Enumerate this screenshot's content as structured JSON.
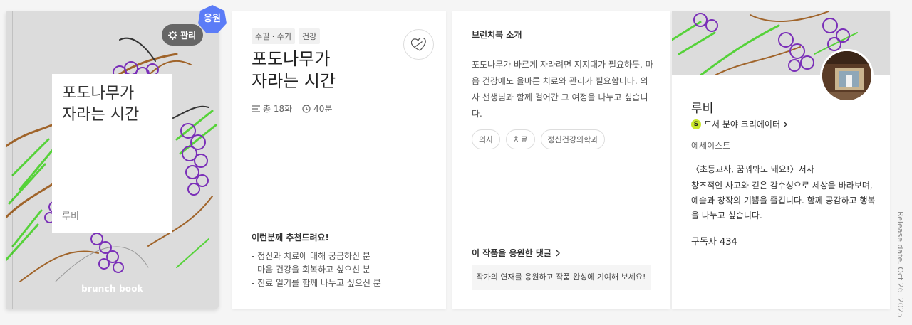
{
  "cover": {
    "title_line1": "포도나무가",
    "title_line2": "자라는 시간",
    "author": "루비",
    "brand": "brunch book",
    "manage_label": "관리",
    "badge_label": "응원"
  },
  "book": {
    "tags": [
      "수필 · 수기",
      "건강"
    ],
    "title_line1": "포도나무가",
    "title_line2": "자라는 시간",
    "episodes": "총 18화",
    "duration": "40분",
    "recommend_title": "이런분께 추천드려요!",
    "recommend_items": [
      "정신과 치료에 대해 궁금하신 분",
      "마음 건강을 회복하고 싶으신 분",
      "진료 일기를 함께 나누고 싶으신 분"
    ]
  },
  "intro": {
    "heading": "브런치북 소개",
    "text": "포도나무가 바르게 자라려면 지지대가 필요하듯, 마음 건강에도 올바른 치료와 관리가 필요합니다. 의사 선생님과 함께 걸어간 그 여정을 나누고 싶습니다.",
    "keywords": [
      "의사",
      "치료",
      "정신건강의학과"
    ],
    "comment_link": "이 작품을 응원한 댓글",
    "comment_prompt": "작가의 연재를 응원하고 작품 완성에 기여해 보세요!"
  },
  "author": {
    "name": "루비",
    "creator_badge": "S",
    "creator_label": "도서 분야 크리에이터",
    "job": "에세이스트",
    "books": "〈초등교사, 꿈꿔봐도 돼요!〉저자",
    "bio": "창조적인 사고와 깊은 감수성으로 세상을 바라보며, 예술과 창작의 기쁨을 즐깁니다. 함께 공감하고 행복을 나누고 싶습니다.",
    "subscribers": "구독자 434"
  },
  "release_date": "Release date. Oct 26. 2025",
  "colors": {
    "badge": "#5b7cf7",
    "creator_badge": "#c9e82a",
    "manage_btn": "#666666"
  }
}
